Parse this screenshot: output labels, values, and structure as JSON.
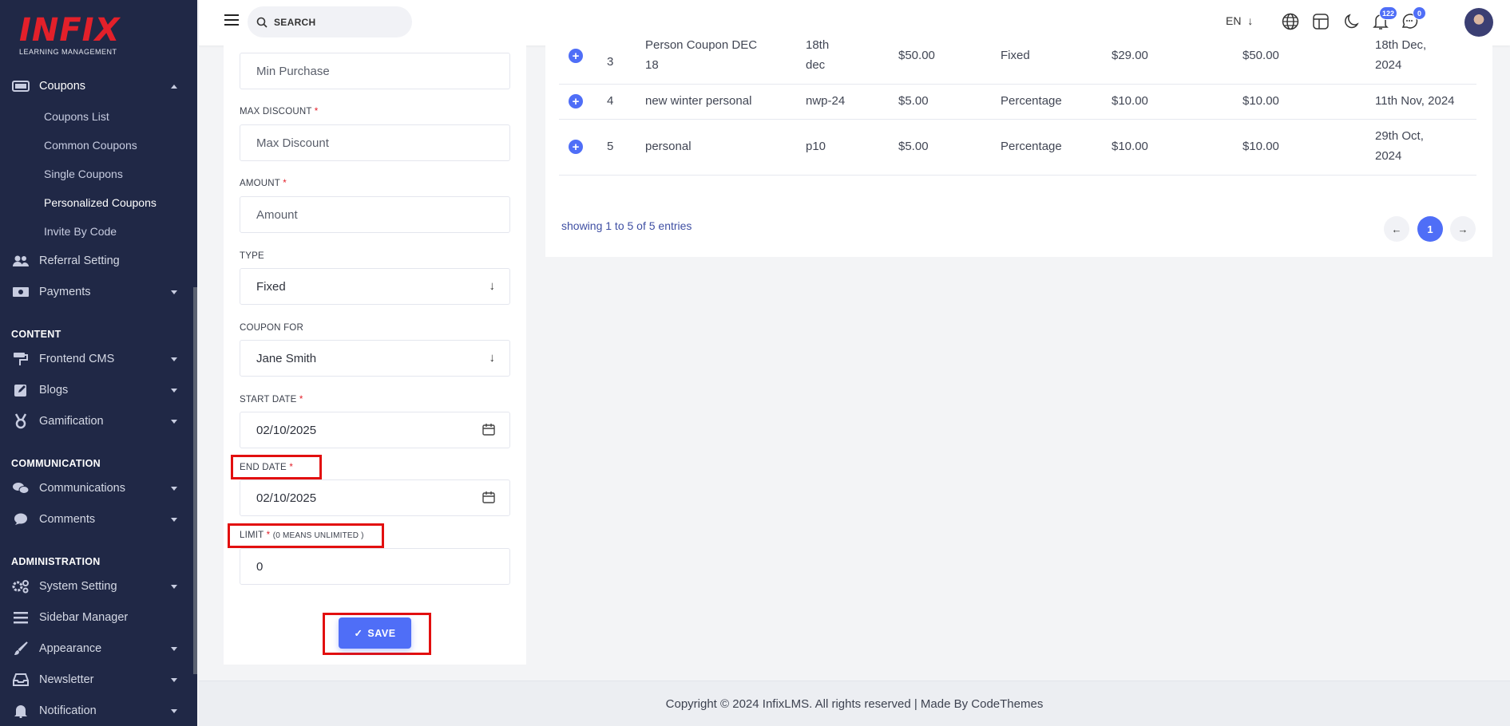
{
  "logo": {
    "word": "INFIX",
    "tagline": "LEARNING MANAGEMENT"
  },
  "sidebar": {
    "coupons": "Coupons",
    "sub_items": [
      "Coupons List",
      "Common Coupons",
      "Single Coupons",
      "Personalized Coupons",
      "Invite By Code"
    ],
    "referral": "Referral Setting",
    "payments": "Payments",
    "content_head": "CONTENT",
    "frontend_cms": "Frontend CMS",
    "blogs": "Blogs",
    "gamification": "Gamification",
    "communication_head": "COMMUNICATION",
    "communications": "Communications",
    "comments": "Comments",
    "administration_head": "ADMINISTRATION",
    "system_setting": "System Setting",
    "sidebar_manager": "Sidebar Manager",
    "appearance": "Appearance",
    "newsletter": "Newsletter",
    "notification": "Notification"
  },
  "topbar": {
    "search_label": "SEARCH",
    "lang": "EN",
    "notification_count": "122",
    "message_count": "0"
  },
  "form": {
    "min_purchase_placeholder": "Min Purchase",
    "max_discount_label": "MAX DISCOUNT",
    "max_discount_placeholder": "Max Discount",
    "amount_label": "AMOUNT",
    "amount_placeholder": "Amount",
    "type_label": "TYPE",
    "type_value": "Fixed",
    "coupon_for_label": "COUPON FOR",
    "coupon_for_value": "Jane Smith",
    "start_date_label": "START DATE",
    "start_date_value": "02/10/2025",
    "end_date_label": "END DATE",
    "end_date_value": "02/10/2025",
    "limit_label": "LIMIT",
    "limit_note": "(0 MEANS UNLIMITED )",
    "limit_value": "0",
    "required_mark": "*",
    "save_label": "SAVE"
  },
  "table": {
    "rows": [
      {
        "sl": "3",
        "title_lines": [
          "Person Coupon DEC",
          "18"
        ],
        "code_lines": [
          "18th",
          "dec"
        ],
        "min": "$50.00",
        "type": "Fixed",
        "max_discount": "$29.00",
        "amount": "$50.00",
        "expiry_lines": [
          "18th Dec,",
          "2024"
        ]
      },
      {
        "sl": "4",
        "title_lines": [
          "new winter personal"
        ],
        "code_lines": [
          "nwp-24"
        ],
        "min": "$5.00",
        "type": "Percentage",
        "max_discount": "$10.00",
        "amount": "$10.00",
        "expiry_lines": [
          "11th Nov, 2024"
        ]
      },
      {
        "sl": "5",
        "title_lines": [
          "personal"
        ],
        "code_lines": [
          "p10"
        ],
        "min": "$5.00",
        "type": "Percentage",
        "max_discount": "$10.00",
        "amount": "$10.00",
        "expiry_lines": [
          "29th Oct,",
          "2024"
        ]
      }
    ],
    "showing": "showing 1 to 5 of 5 entries",
    "current_page": "1"
  },
  "footer": "Copyright © 2024 InfixLMS. All rights reserved | Made By CodeThemes",
  "colors": {
    "sidebar_bg": "#202846",
    "accent": "#4f6ef7",
    "brand_red": "#e3202a",
    "highlight_box": "#e20f0f"
  }
}
